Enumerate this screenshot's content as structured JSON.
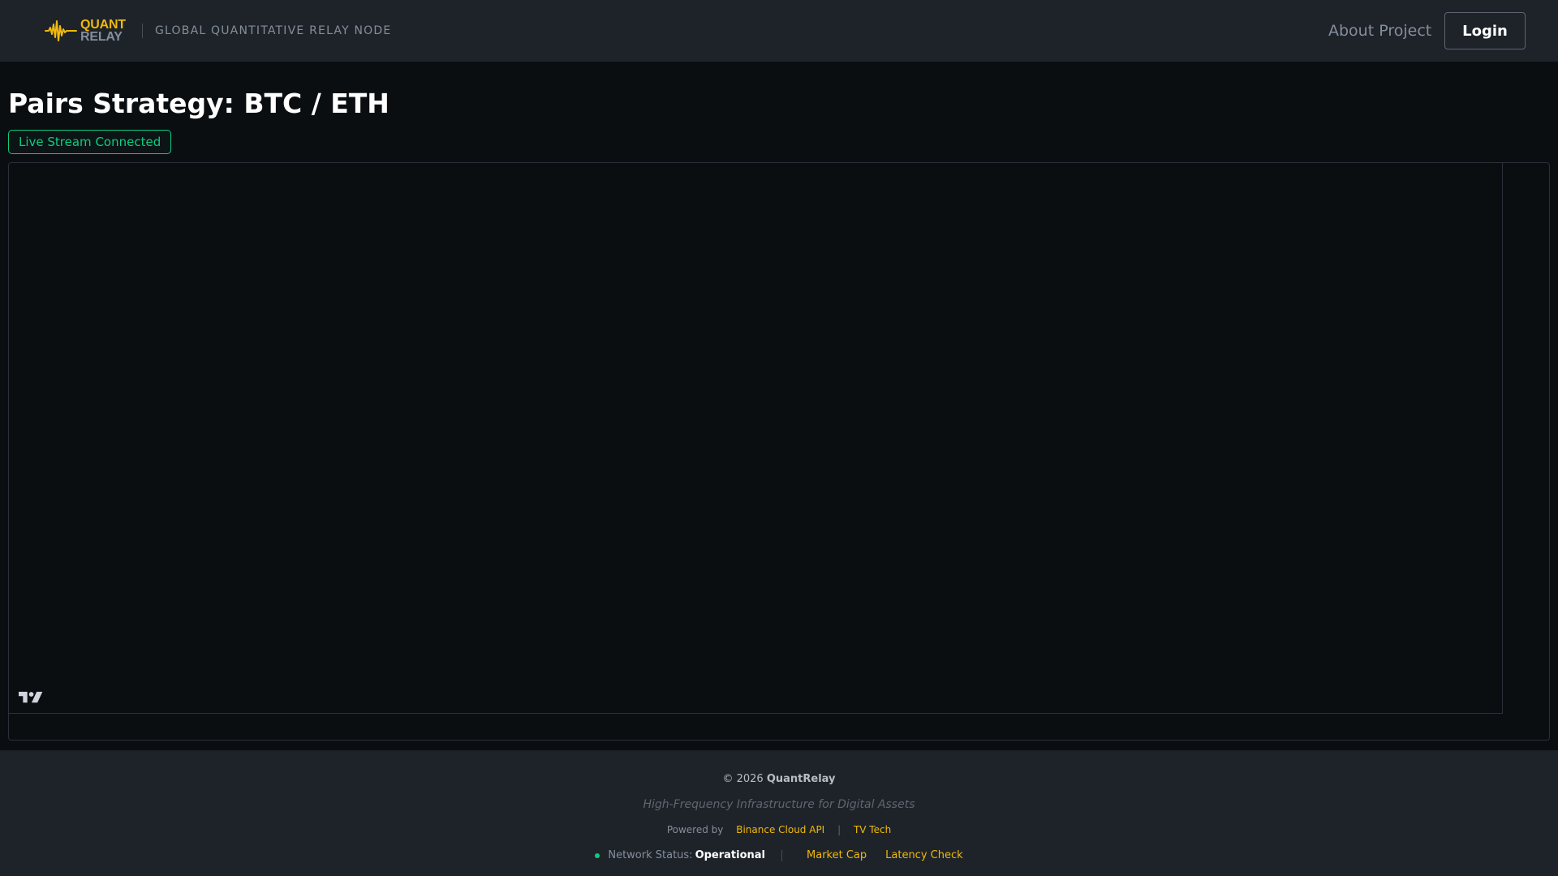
{
  "header": {
    "logo": {
      "line1": "QUANT",
      "line2": "RELAY",
      "icon": "waveform-logo-icon"
    },
    "tagline": "GLOBAL QUANTITATIVE RELAY NODE",
    "nav": {
      "about_label": "About Project",
      "login_label": "Login"
    }
  },
  "main": {
    "title": "Pairs Strategy: BTC / ETH",
    "stream_status": "Live Stream Connected",
    "chart": {
      "watermark_icon": "tradingview-logo-icon"
    }
  },
  "footer": {
    "copyright_prefix": "© 2026",
    "copyright_brand": "QuantRelay",
    "slogan": "High-Frequency Infrastructure for Digital Assets",
    "powered_by_label": "Powered by",
    "powered_by_links": [
      "Binance Cloud API",
      "TV Tech"
    ],
    "powered_by_separator": "|",
    "network_status_label": "Network Status:",
    "network_status_value": "Operational",
    "links": [
      "Market Cap",
      "Latency Check"
    ]
  },
  "colors": {
    "background": "#0b0e11",
    "surface": "#1e2329",
    "accent": "#f0b90b",
    "success": "#0ecb81",
    "muted": "#848e9c"
  }
}
